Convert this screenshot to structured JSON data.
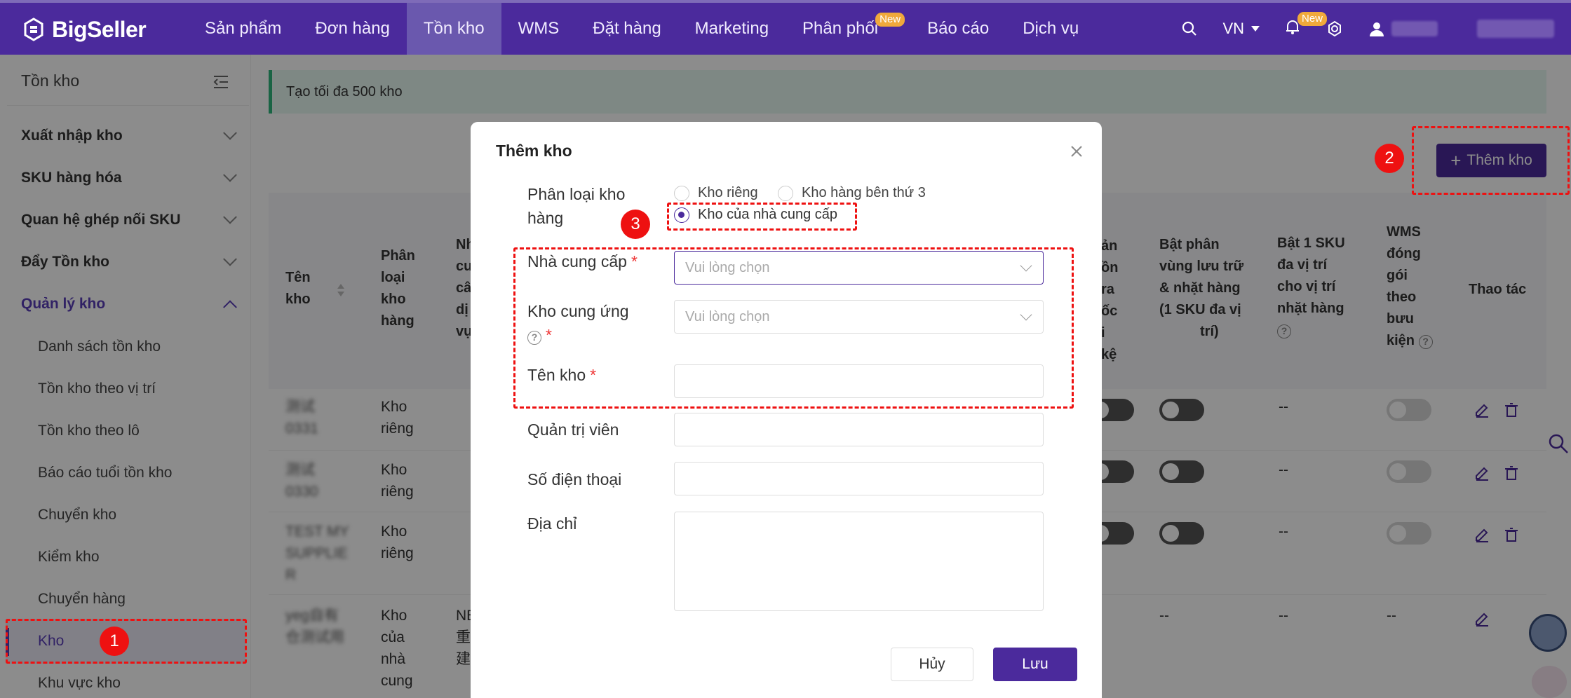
{
  "app": {
    "name": "BigSeller"
  },
  "nav": {
    "items": [
      "Sản phẩm",
      "Đơn hàng",
      "Tồn kho",
      "WMS",
      "Đặt hàng",
      "Marketing",
      "Phân phối",
      "Báo cáo",
      "Dịch vụ"
    ],
    "active": "Tồn kho",
    "badge_new": "New",
    "lang": "VN",
    "bell_badge": "New"
  },
  "sidebar": {
    "title": "Tồn kho",
    "groups": [
      "Xuất nhập kho",
      "SKU hàng hóa",
      "Quan hệ ghép nối SKU",
      "Đẩy Tồn kho",
      "Quản lý kho"
    ],
    "sub_items": [
      "Danh sách tồn kho",
      "Tồn kho theo vị trí",
      "Tồn kho theo lô",
      "Báo cáo tuổi tồn kho",
      "Chuyển kho",
      "Kiểm kho",
      "Chuyển hàng",
      "Kho",
      "Khu vực kho"
    ],
    "active_item": "Kho"
  },
  "main": {
    "info": "Tạo tối đa 500 kho",
    "add_button": "Thêm kho",
    "columns": {
      "c1": [
        "Tên",
        "kho"
      ],
      "c2": [
        "Phân",
        "loại",
        "kho",
        "hàng"
      ],
      "c3": [
        "Nh",
        "cu",
        "câ",
        "dị",
        "vụ"
      ],
      "c4": [
        "ản",
        "ồn",
        "",
        "ra",
        "ốc",
        "i",
        "kệ"
      ],
      "c5": [
        "Bật phân",
        "vùng lưu trữ",
        "& nhặt hàng",
        "(1 SKU đa vị",
        "trí)"
      ],
      "c6": [
        "Bật 1 SKU",
        "đa vị trí",
        "cho vị trí",
        "nhặt hàng"
      ],
      "c7": [
        "WMS",
        "đóng",
        "gói",
        "theo",
        "bưu",
        "kiện"
      ],
      "c8": "Thao tác"
    },
    "rows": [
      {
        "name": [
          "测试",
          "0331"
        ],
        "type": [
          "Kho",
          "riêng"
        ],
        "dash1": "--"
      },
      {
        "name": [
          "测试",
          "0330"
        ],
        "type": [
          "Kho",
          "riêng"
        ],
        "dash1": "--"
      },
      {
        "name": [
          "TEST MY",
          "SUPPLIE",
          "R"
        ],
        "type": [
          "Kho",
          "riêng"
        ],
        "dash1": "--"
      },
      {
        "name": [
          "yeg自有",
          "仓测试用"
        ],
        "type": [
          "Kho",
          "của",
          "nhà",
          "cung"
        ],
        "svc": [
          "NE",
          "重",
          "建"
        ],
        "dash0": "--",
        "dash1": "--",
        "dash2": "--"
      }
    ]
  },
  "modal": {
    "title": "Thêm kho",
    "type_label": [
      "Phân loại kho",
      "hàng"
    ],
    "options": [
      "Kho riêng",
      "Kho hàng bên thứ 3",
      "Kho của nhà cung cấp"
    ],
    "selected": "Kho của nhà cung cấp",
    "supplier_label": "Nhà cung cấp",
    "supply_wh_label": "Kho cung ứng",
    "name_label": "Tên kho",
    "admin_label": "Quản trị viên",
    "phone_label": "Số điện thoại",
    "address_label": "Địa chỉ",
    "select_placeholder": "Vui lòng chọn",
    "required_mark": "*",
    "cancel": "Hủy",
    "save": "Lưu"
  },
  "markers": [
    "1",
    "2",
    "3"
  ],
  "colors": {
    "brand": "#4b2a9c",
    "marker": "#ee1111",
    "info_bg": "#e6f7f0",
    "info_border": "#2fb67c"
  }
}
